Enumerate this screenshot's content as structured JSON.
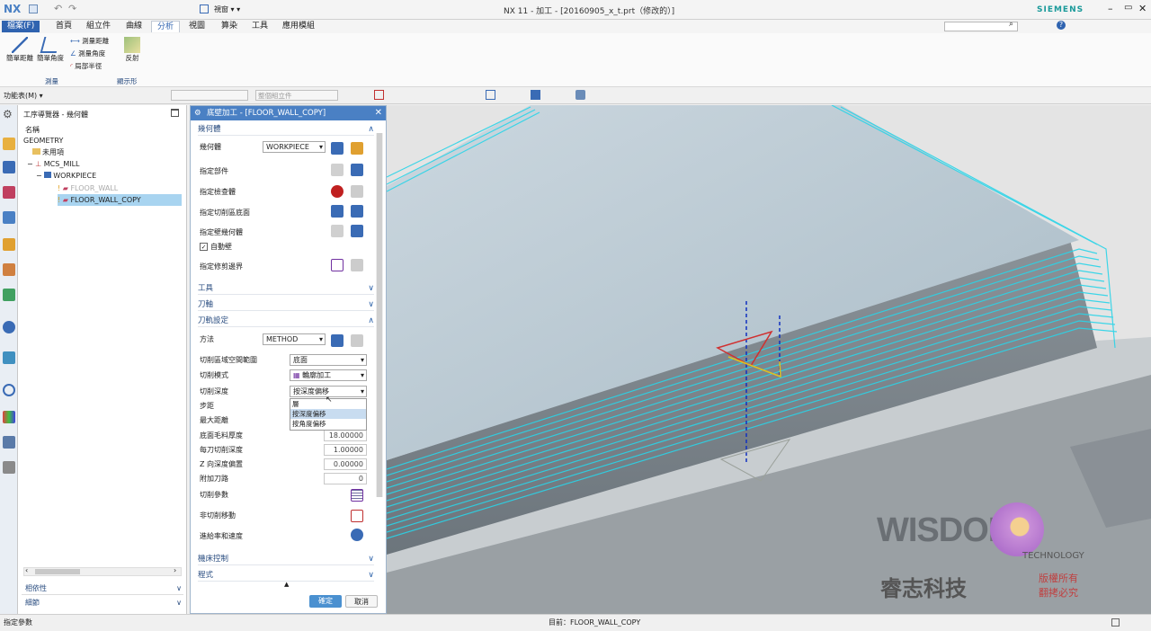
{
  "app": {
    "logo": "NX",
    "window_title": "NX 11 - 加工 - [20160905_x_t.prt（修改的）]",
    "brand": "SIEMENS",
    "window_menu": "視窗 ▾ ▾",
    "search_placeholder": "尋找指令"
  },
  "menus": [
    "檔案(F)",
    "首頁",
    "組立件",
    "曲線",
    "分析",
    "視圖",
    "算染",
    "工具",
    "應用模組"
  ],
  "active_menu": "分析",
  "ribbon": {
    "group1": {
      "buttons": [
        "簡單距離",
        "簡單角度"
      ],
      "small": [
        "測量距離",
        "測量角度",
        "局部半徑"
      ],
      "label": "測量"
    },
    "reflect": "反射",
    "group2_label": "顯示形"
  },
  "toolbar": {
    "menu_label": "功能表(M) ▾",
    "select_placeholder": "整個組立件"
  },
  "navigator": {
    "title": "工序導覽器 - 幾何體",
    "header": "名稱",
    "items": [
      {
        "label": "GEOMETRY"
      },
      {
        "label": "未用項"
      },
      {
        "label": "MCS_MILL"
      },
      {
        "label": "WORKPIECE"
      },
      {
        "label": "FLOOR_WALL"
      },
      {
        "label": "FLOOR_WALL_COPY"
      }
    ],
    "footer": [
      "相依性",
      "細節"
    ]
  },
  "dialog": {
    "title": "底壁加工 - [FLOOR_WALL_COPY]",
    "sections": {
      "geometry": "幾何體",
      "tool": "工具",
      "axis": "刀軸",
      "path": "刀軌設定",
      "machine": "機床控制",
      "program": "程式"
    },
    "geometry_label": "幾何體",
    "geometry_value": "WORKPIECE",
    "rows": [
      "指定部件",
      "指定檢查體",
      "指定切削區底面",
      "指定壁幾何體",
      "自動壁",
      "指定修剪邊界"
    ],
    "method_label": "方法",
    "method_value": "METHOD",
    "cut_region_label": "切削區域空間範圍",
    "cut_region_value": "底面",
    "cut_mode_label": "切削模式",
    "cut_mode_value": "輪廓加工",
    "cut_depth_label": "切削深度",
    "cut_depth_value": "按深度偏移",
    "dropdown_options": [
      "層",
      "按深度偏移",
      "按角度偏移"
    ],
    "stepover_label": "步距",
    "max_dist_label": "最大距離",
    "fields": [
      {
        "label": "底面毛料厚度",
        "value": "18.00000"
      },
      {
        "label": "每刀切削深度",
        "value": "1.00000"
      },
      {
        "label": "Z 向深度偏置",
        "value": "0.00000"
      },
      {
        "label": "附加刀路",
        "value": "0"
      }
    ],
    "params": [
      "切削參數",
      "非切削移動",
      "進給率和速度"
    ],
    "ok": "確定",
    "cancel": "取消"
  },
  "watermark": {
    "en": "WISDOM",
    "sub": "TECHNOLOGY",
    "cn": "睿志科技",
    "rights1": "版權所有",
    "rights2": "翻拷必究"
  },
  "status": {
    "left": "指定參數",
    "center": "目前：FLOOR_WALL_COPY"
  },
  "colors": {
    "accent": "#2f63b0",
    "title_bar": "#4a80c4",
    "path": "#2ad4e8"
  }
}
